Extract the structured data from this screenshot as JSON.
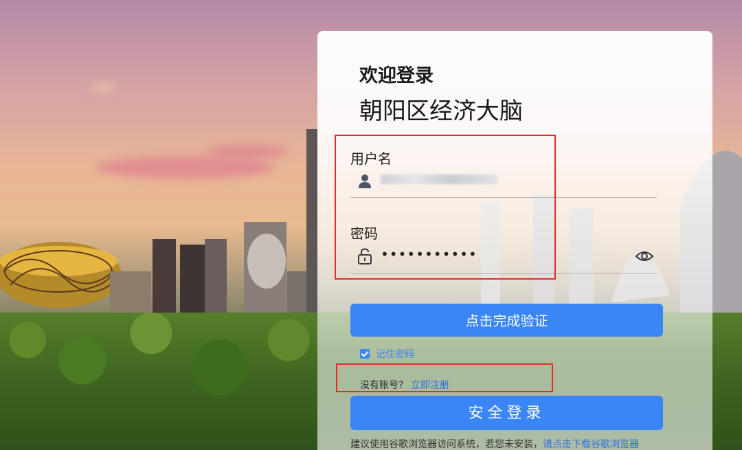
{
  "header": {
    "welcome": "欢迎登录",
    "system_name": "朝阳区经济大脑"
  },
  "form": {
    "username_label": "用户名",
    "username_value": "••••••••••••••",
    "password_label": "密码",
    "password_value": "•••••••••••",
    "verify_button": "点击完成验证",
    "remember_label": "记住密码",
    "remember_checked": true,
    "no_account_text": "没有账号?",
    "register_link": "立即注册",
    "login_button": "安全登录"
  },
  "footer": {
    "hint_text": "建议使用谷歌浏览器访问系统，若您未安装，",
    "hint_link": "请点击下载谷歌浏览器"
  },
  "icons": {
    "username": "user-icon",
    "password": "lock-icon",
    "toggle_visibility": "eye-icon"
  },
  "colors": {
    "primary": "#3a86f5",
    "link": "#2f6fe0",
    "highlight_box": "#e8282c"
  }
}
